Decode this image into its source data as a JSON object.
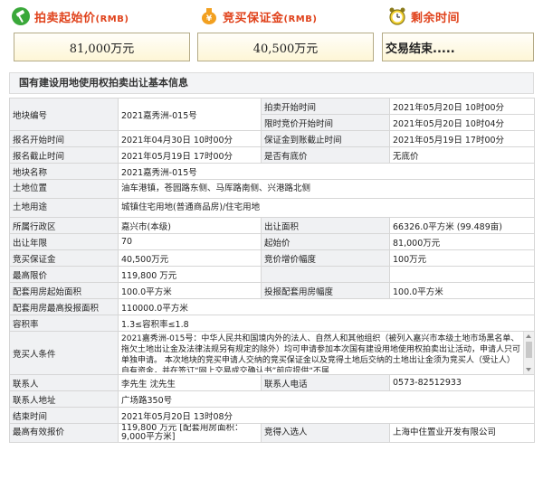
{
  "header": {
    "start_price_label": "拍卖起始价",
    "start_price_unit": "(RMB)",
    "deposit_label": "竞买保证金",
    "deposit_unit": "(RMB)",
    "time_left_label": "剩余时间",
    "start_price_value": "81,000万元",
    "deposit_value": "40,500万元",
    "status_value": "交易结束....."
  },
  "section_title": "国有建设用地使用权拍卖出让基本信息",
  "rows": {
    "r1": {
      "l1": "地块编号",
      "v1": "2021嘉秀洲-015号",
      "l2": "拍卖开始时间",
      "v2": "2021年05月20日 10时00分"
    },
    "r2": {
      "l2": "限时竞价开始时间",
      "v2": "2021年05月20日 10时04分"
    },
    "r3": {
      "l1": "报名开始时间",
      "v1": "2021年04月30日 10时00分",
      "l2": "保证金到账截止时间",
      "v2": "2021年05月19日 17时00分"
    },
    "r4": {
      "l1": "报名截止时间",
      "v1": "2021年05月19日 17时00分",
      "l2": "是否有底价",
      "v2": "无底价"
    },
    "r5": {
      "l1": "地块名称",
      "v1": "2021嘉秀洲-015号"
    },
    "r6": {
      "l1": "土地位置",
      "v1": "油车港镇，苍园路东侧、马厍路南侧、兴港路北侧"
    },
    "r7": {
      "l1": "土地用途",
      "v1": "城镇住宅用地(普通商品房)/住宅用地"
    },
    "r8": {
      "l1": "所属行政区",
      "v1": "嘉兴市(本级)",
      "l2": "出让面积",
      "v2": "66326.0平方米 (99.489亩)"
    },
    "r9": {
      "l1": "出让年限",
      "v1": "70",
      "l2": "起始价",
      "v2": "81,000万元"
    },
    "r10": {
      "l1": "竞买保证金",
      "v1": "40,500万元",
      "l2": "竞价增价幅度",
      "v2": "100万元"
    },
    "r11": {
      "l1": "最高限价",
      "v1": "119,800 万元"
    },
    "r12": {
      "l1": "配套用房起始面积",
      "v1": "100.0平方米",
      "l2": "投报配套用房幅度",
      "v2": "100.0平方米"
    },
    "r13": {
      "l1": "配套用房最高投报面积",
      "v1": "110000.0平方米"
    },
    "r14": {
      "l1": "容积率",
      "v1": "1.3≤容积率≤1.8"
    },
    "r15": {
      "l1": "竞买人条件",
      "v1": "2021嘉秀洲-015号：中华人民共和国境内外的法人、自然人和其他组织（被列入嘉兴市本级土地市场黑名单、拖欠土地出让金及法律法规另有规定的除外）均可申请参加本次国有建设用地使用权拍卖出让活动，申请人只可单独申请。 本次地块的竞买申请人交纳的竞买保证金以及竞得土地后交纳的土地出让金须为竞买人（受让人）自有资金，并在签订“网上交易成交确认书”前应提供“不属"
    },
    "r16": {
      "l1": "联系人",
      "v1": "李先生 沈先生",
      "l2": "联系人电话",
      "v2": "0573-82512933"
    },
    "r17": {
      "l1": "联系人地址",
      "v1": "广场路350号"
    },
    "r18": {
      "l1": "结束时间",
      "v1": "2021年05月20日 13时08分"
    },
    "r19": {
      "l1": "最高有效报价",
      "v1": "119,800 万元 [配套用房面积：9,000平方米]",
      "l2": "竞得入选人",
      "v2": "上海中住置业开发有限公司"
    }
  }
}
